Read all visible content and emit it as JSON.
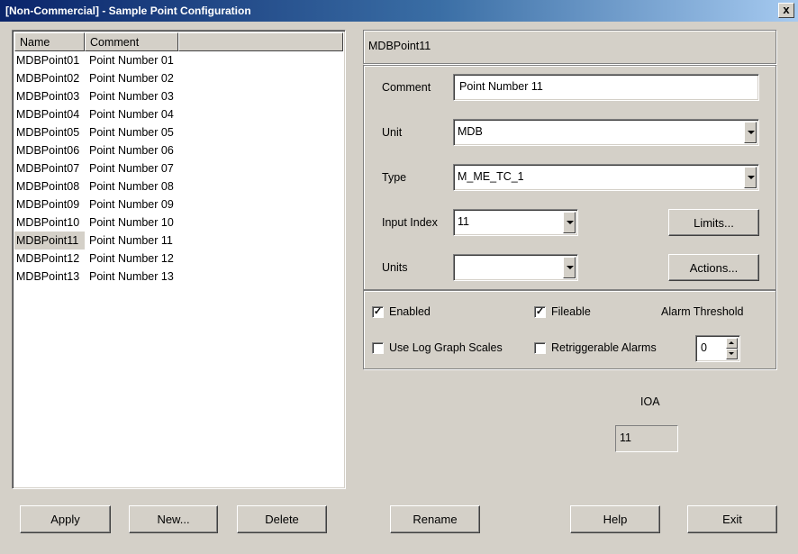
{
  "window": {
    "title": "[Non-Commercial] - Sample Point Configuration",
    "close_glyph": "x"
  },
  "list": {
    "columns": [
      "Name",
      "Comment"
    ],
    "rows": [
      {
        "name": "MDBPoint01",
        "comment": "Point Number 01"
      },
      {
        "name": "MDBPoint02",
        "comment": "Point Number 02"
      },
      {
        "name": "MDBPoint03",
        "comment": "Point Number 03"
      },
      {
        "name": "MDBPoint04",
        "comment": "Point Number 04"
      },
      {
        "name": "MDBPoint05",
        "comment": "Point Number 05"
      },
      {
        "name": "MDBPoint06",
        "comment": "Point Number 06"
      },
      {
        "name": "MDBPoint07",
        "comment": "Point Number 07"
      },
      {
        "name": "MDBPoint08",
        "comment": "Point Number 08"
      },
      {
        "name": "MDBPoint09",
        "comment": "Point Number 09"
      },
      {
        "name": "MDBPoint10",
        "comment": "Point Number 10"
      },
      {
        "name": "MDBPoint11",
        "comment": "Point Number 11"
      },
      {
        "name": "MDBPoint12",
        "comment": "Point Number 12"
      },
      {
        "name": "MDBPoint13",
        "comment": "Point Number 13"
      }
    ],
    "selected_index": 10
  },
  "detail": {
    "point_name": "MDBPoint11",
    "comment_label": "Comment",
    "comment_value": "Point Number 11",
    "unit_label": "Unit",
    "unit_value": "MDB",
    "type_label": "Type",
    "type_value": "M_ME_TC_1",
    "input_index_label": "Input Index",
    "input_index_value": "11",
    "units_label": "Units",
    "units_value": "",
    "limits_button": "Limits...",
    "actions_button": "Actions..."
  },
  "options": {
    "enabled_label": "Enabled",
    "enabled_checked": true,
    "fileable_label": "Fileable",
    "fileable_checked": true,
    "alarm_threshold_label": "Alarm Threshold",
    "log_scales_label": "Use Log Graph Scales",
    "log_scales_checked": false,
    "retrig_label": "Retriggerable Alarms",
    "retrig_checked": false,
    "alarm_threshold_value": "0",
    "check_glyph": "✓"
  },
  "ioa": {
    "label": "IOA",
    "value": "11"
  },
  "buttons": {
    "apply": "Apply",
    "new": "New...",
    "delete": "Delete",
    "rename": "Rename",
    "help": "Help",
    "exit": "Exit"
  }
}
